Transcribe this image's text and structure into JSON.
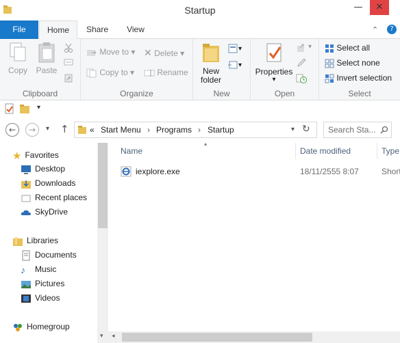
{
  "window": {
    "title": "Startup",
    "minimize_glyph": "—",
    "close_glyph": "✕"
  },
  "tabs": {
    "file": "File",
    "home": "Home",
    "share": "Share",
    "view": "View",
    "collapse_glyph": "⌃",
    "help_glyph": "?"
  },
  "ribbon": {
    "clipboard": {
      "label": "Clipboard",
      "copy": "Copy",
      "paste": "Paste"
    },
    "organize": {
      "label": "Organize",
      "move_to": "Move to",
      "copy_to": "Copy to",
      "delete": "Delete",
      "rename": "Rename"
    },
    "new": {
      "label": "New",
      "new_folder_line1": "New",
      "new_folder_line2": "folder"
    },
    "open": {
      "label": "Open",
      "properties": "Properties"
    },
    "select": {
      "label": "Select",
      "select_all": "Select all",
      "select_none": "Select none",
      "invert_selection": "Invert selection"
    }
  },
  "address": {
    "overflow": "«",
    "crumbs": [
      "Start Menu",
      "Programs",
      "Startup"
    ],
    "separator": "›",
    "search_placeholder": "Search Sta..."
  },
  "nav": {
    "favorites": "Favorites",
    "favorites_items": [
      "Desktop",
      "Downloads",
      "Recent places",
      "SkyDrive"
    ],
    "libraries": "Libraries",
    "libraries_items": [
      "Documents",
      "Music",
      "Pictures",
      "Videos"
    ],
    "homegroup": "Homegroup"
  },
  "columns": {
    "name": "Name",
    "date_modified": "Date modified",
    "type": "Type"
  },
  "files": [
    {
      "name": "iexplore.exe",
      "date": "18/11/2555 8:07",
      "type": "Short"
    }
  ],
  "colors": {
    "accent": "#1979ca",
    "close": "#e04343",
    "folder": "#e8c158"
  }
}
